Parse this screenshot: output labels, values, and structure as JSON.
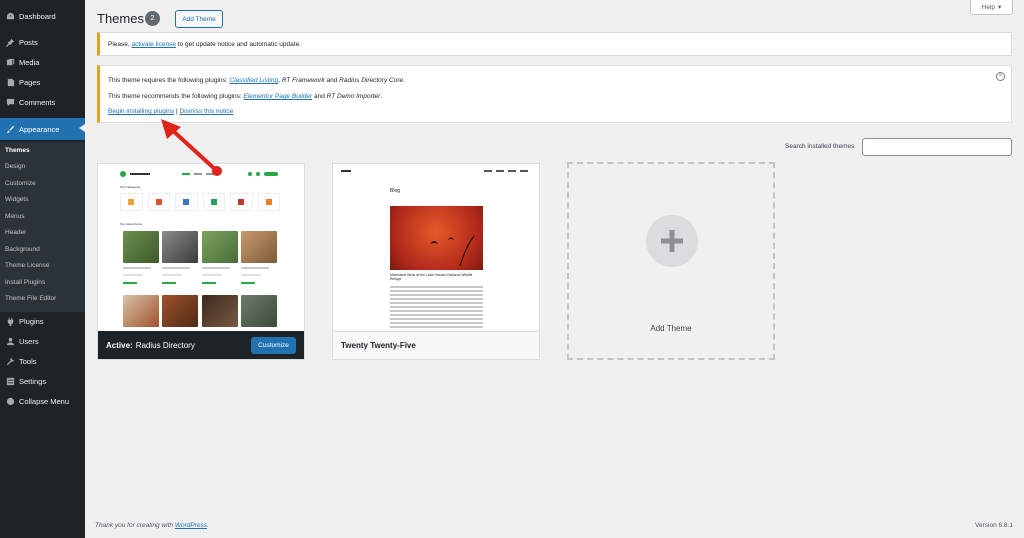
{
  "sidebar": {
    "items": [
      {
        "label": "Dashboard",
        "icon": "dashboard-icon"
      },
      {
        "label": "Posts",
        "icon": "pin-icon"
      },
      {
        "label": "Media",
        "icon": "media-icon"
      },
      {
        "label": "Pages",
        "icon": "page-icon"
      },
      {
        "label": "Comments",
        "icon": "comment-icon"
      },
      {
        "label": "Appearance",
        "icon": "paintbrush-icon",
        "current": true
      },
      {
        "label": "Plugins",
        "icon": "plugin-icon"
      },
      {
        "label": "Users",
        "icon": "user-icon"
      },
      {
        "label": "Tools",
        "icon": "wrench-icon"
      },
      {
        "label": "Settings",
        "icon": "settings-icon"
      },
      {
        "label": "Collapse Menu",
        "icon": "collapse-icon"
      }
    ],
    "submenu": [
      "Themes",
      "Design",
      "Customize",
      "Widgets",
      "Menus",
      "Header",
      "Background",
      "Theme License",
      "Install Plugins",
      "Theme File Editor"
    ]
  },
  "header": {
    "title": "Themes",
    "count": "2",
    "add_button": "Add Theme",
    "help_button": "Help"
  },
  "notices": {
    "license": {
      "prefix": "Please,",
      "link": "activate license",
      "suffix": "to get update notice and automatic update."
    },
    "plugins": {
      "required_prefix": "This theme requires the following plugins:",
      "required_1": "Classified Listing",
      "required_2": "RT Framework",
      "required_and": "and",
      "required_3": "Radius Directory Core",
      "recommended_prefix": "This theme recommends the following plugins:",
      "recommended_1": "Elementor Page Builder",
      "recommended_and": "and",
      "recommended_2": "RT Demo Importer",
      "begin_link": "Begin installing plugins",
      "separator": "|",
      "dismiss_link": "Dismiss this notice"
    }
  },
  "search": {
    "label": "Search installed themes",
    "value": ""
  },
  "themes": [
    {
      "active_prefix": "Active:",
      "name": "Radius Directory",
      "customize": "Customize",
      "shot_categories": "Top Categories",
      "shot_listings": "Top Listed Items"
    },
    {
      "name": "Twenty Twenty-Five",
      "shot_blog": "Blog",
      "shot_headline": "Marshland Birds at the Lake Havasu National Wildlife Refuge"
    }
  ],
  "add_theme_card": {
    "label": "Add Theme"
  },
  "footer": {
    "thanks_prefix": "Thank you for creating with",
    "thanks_link": "WordPress",
    "thanks_suffix": ".",
    "version": "Version 6.8.1"
  },
  "colors": {
    "sidebar_bg": "#1d2327",
    "accent": "#2271b1",
    "notice_border": "#dba617",
    "arrow": "#e0231b"
  }
}
